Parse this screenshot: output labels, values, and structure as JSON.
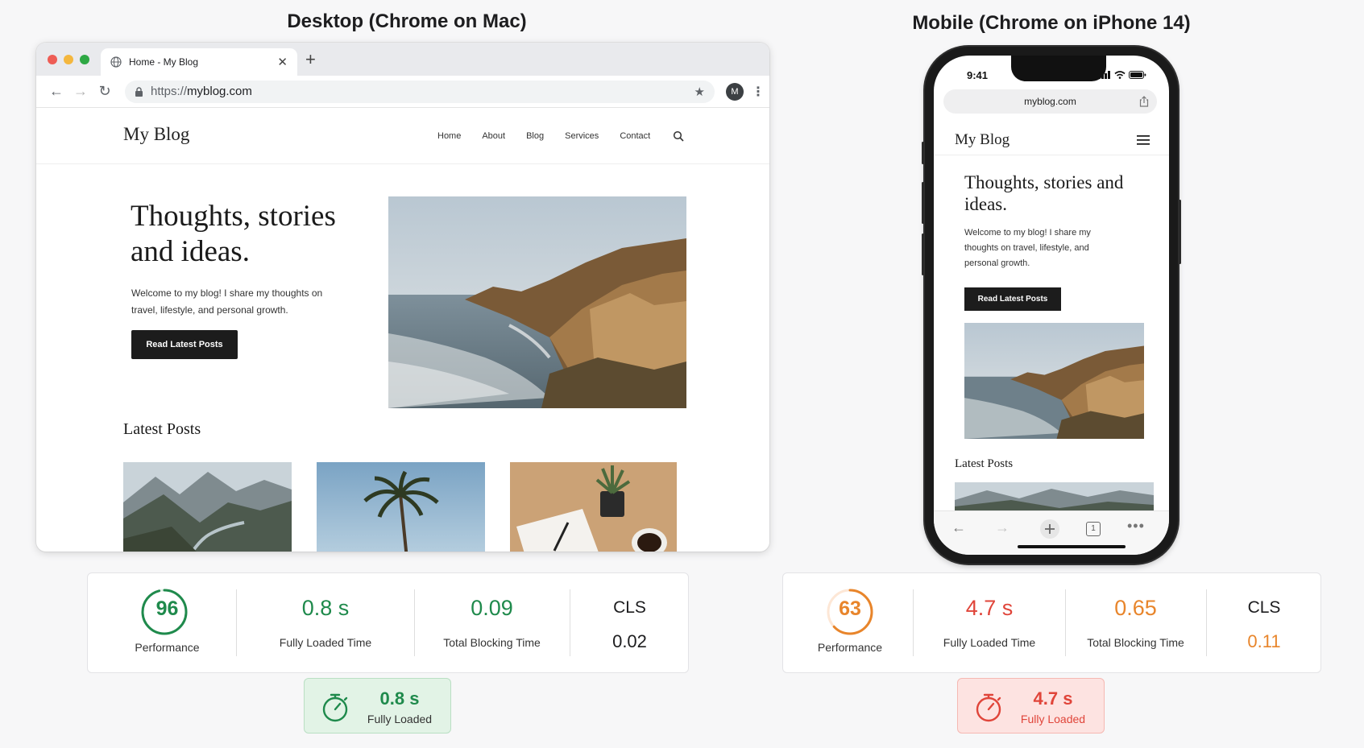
{
  "desktop": {
    "section_title": "Desktop (Chrome on Mac)",
    "tab_title": "Home - My Blog",
    "url_scheme": "https://",
    "url_host": "myblog.com",
    "profile_initial": "M",
    "site": {
      "brand": "My Blog",
      "nav": [
        "Home",
        "About",
        "Blog",
        "Services",
        "Contact"
      ],
      "hero_title": "Thoughts, stories and ideas.",
      "hero_text": "Welcome to my blog! I share my thoughts on travel, lifestyle, and personal growth.",
      "cta": "Read Latest Posts",
      "latest_title": "Latest Posts"
    },
    "metrics": {
      "performance": 96,
      "performance_label": "Performance",
      "fully_loaded": "0.8 s",
      "fully_loaded_label": "Fully Loaded Time",
      "tbt": "0.09",
      "tbt_label": "Total Blocking Time",
      "cls_label": "CLS",
      "cls": "0.02"
    },
    "badge": {
      "value": "0.8 s",
      "label": "Fully Loaded"
    },
    "colors": {
      "good": "#1f8a4c",
      "badge_bg": "#e2f3e6",
      "badge_border": "#b9dfc3"
    }
  },
  "mobile": {
    "section_title": "Mobile (Chrome on iPhone 14)",
    "status_time": "9:41",
    "url": "myblog.com",
    "tab_count": "1",
    "site": {
      "brand": "My Blog",
      "hero_title": "Thoughts, stories and ideas.",
      "hero_text": "Welcome to my blog! I share my thoughts on travel, lifestyle, and personal growth.",
      "cta": "Read Latest Posts",
      "latest_title": "Latest Posts"
    },
    "metrics": {
      "performance": 63,
      "performance_label": "Performance",
      "fully_loaded": "4.7 s",
      "fully_loaded_label": "Fully Loaded Time",
      "tbt": "0.65",
      "tbt_label": "Total Blocking Time",
      "cls_label": "CLS",
      "cls": "0.11"
    },
    "badge": {
      "value": "4.7 s",
      "label": "Fully Loaded"
    },
    "colors": {
      "bad": "#e0453a",
      "warn": "#e8852b",
      "badge_bg": "#fde3e1",
      "badge_border": "#f5b8b2"
    }
  },
  "icons": [
    "globe-icon",
    "back-icon",
    "forward-icon",
    "reload-icon",
    "lock-icon",
    "star-icon",
    "kebab-icon",
    "search-icon",
    "menu-icon",
    "share-icon",
    "timer-icon",
    "add-tab-icon",
    "tabs-icon",
    "more-icon"
  ]
}
